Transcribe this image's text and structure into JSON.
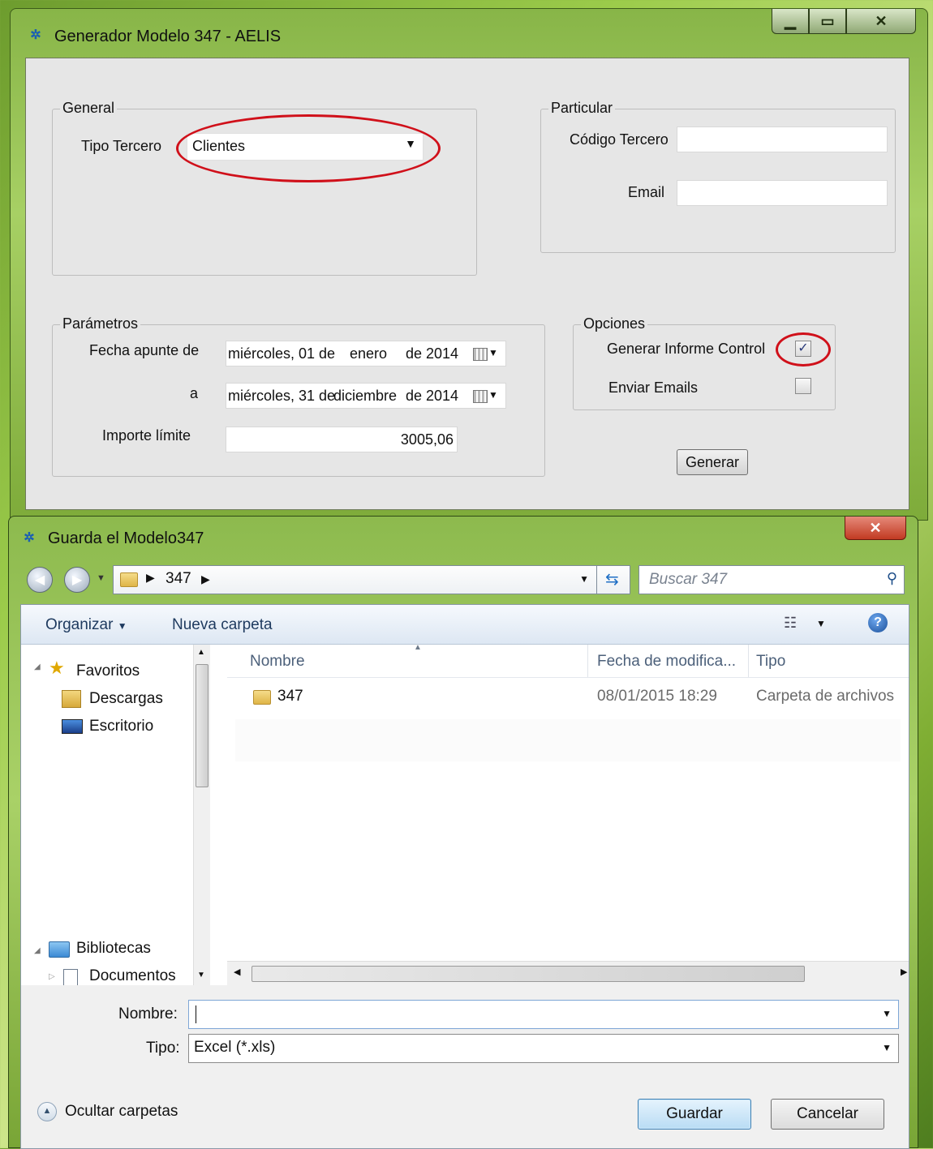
{
  "window1": {
    "title": "Generador Modelo 347 - AELIS",
    "general": {
      "legend": "General",
      "tipo_tercero_label": "Tipo Tercero",
      "tipo_tercero_value": "Clientes"
    },
    "particular": {
      "legend": "Particular",
      "codigo_label": "Código Tercero",
      "codigo_value": "",
      "email_label": "Email",
      "email_value": ""
    },
    "parametros": {
      "legend": "Parámetros",
      "fecha_de_label": "Fecha apunte de",
      "fecha_de_weekday": "miércoles, 01 de",
      "fecha_de_month": "enero",
      "fecha_de_year": "de 2014",
      "fecha_a_label": "a",
      "fecha_a_weekday": "miércoles, 31 de",
      "fecha_a_month": "diciembre",
      "fecha_a_year": "de 2014",
      "importe_label": "Importe límite",
      "importe_value": "3005,06"
    },
    "opciones": {
      "legend": "Opciones",
      "informe_label": "Generar Informe Control",
      "informe_checked": true,
      "emails_label": "Enviar Emails",
      "emails_checked": false
    },
    "generar_button": "Generar"
  },
  "window2": {
    "title": "Guarda el Modelo347",
    "address_segment": "347",
    "search_placeholder": "Buscar 347",
    "toolbar": {
      "organizar": "Organizar",
      "nueva_carpeta": "Nueva carpeta"
    },
    "nav": {
      "favoritos": "Favoritos",
      "descargas": "Descargas",
      "escritorio": "Escritorio",
      "bibliotecas": "Bibliotecas",
      "documentos": "Documentos"
    },
    "columns": {
      "nombre": "Nombre",
      "fecha": "Fecha de modifica...",
      "tipo": "Tipo"
    },
    "files": [
      {
        "name": "347",
        "date": "08/01/2015 18:29",
        "type": "Carpeta de archivos"
      }
    ],
    "nombre_label": "Nombre:",
    "nombre_value": "",
    "tipo_label": "Tipo:",
    "tipo_value": "Excel (*.xls)",
    "ocultar_carpetas": "Ocultar carpetas",
    "guardar_button": "Guardar",
    "cancelar_button": "Cancelar"
  },
  "colors": {
    "highlight_ring": "#d0101a",
    "aero_green": "#a7d064",
    "primary_button": "#b9dcf4"
  }
}
